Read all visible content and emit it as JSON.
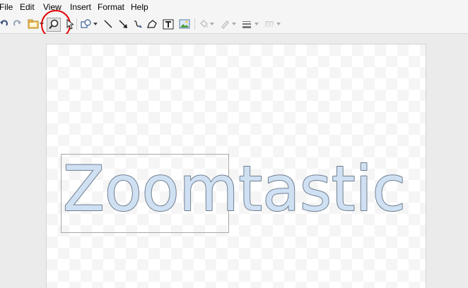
{
  "menu": {
    "items": [
      {
        "label": "File"
      },
      {
        "label": "Edit"
      },
      {
        "label": "View"
      },
      {
        "label": "Insert"
      },
      {
        "label": "Format"
      },
      {
        "label": "Help"
      }
    ]
  },
  "toolbar": {
    "tools": [
      {
        "name": "undo-icon",
        "active": false
      },
      {
        "name": "redo-icon",
        "active": false
      },
      {
        "name": "image-icon",
        "active": false
      },
      {
        "name": "zoom-icon",
        "active": true
      },
      {
        "name": "select-arrow-icon",
        "active": false
      },
      {
        "name": "shape-icon",
        "active": false
      },
      {
        "name": "line-icon",
        "active": false
      },
      {
        "name": "arrow-icon",
        "active": false
      },
      {
        "name": "curve-icon",
        "active": false
      },
      {
        "name": "polyline-icon",
        "active": false
      },
      {
        "name": "text-box-icon",
        "active": false
      },
      {
        "name": "insert-image-icon",
        "active": false
      },
      {
        "name": "fill-color-icon",
        "active": false
      },
      {
        "name": "line-color-icon",
        "active": false
      },
      {
        "name": "line-weight-icon",
        "active": false
      },
      {
        "name": "line-dash-icon",
        "active": false
      }
    ],
    "highlight_color": "#e00000"
  },
  "canvas": {
    "word_art_text": "Zoomtastic",
    "word_art_fill": "#cfe0f3",
    "word_art_stroke": "#6e7d8e"
  }
}
